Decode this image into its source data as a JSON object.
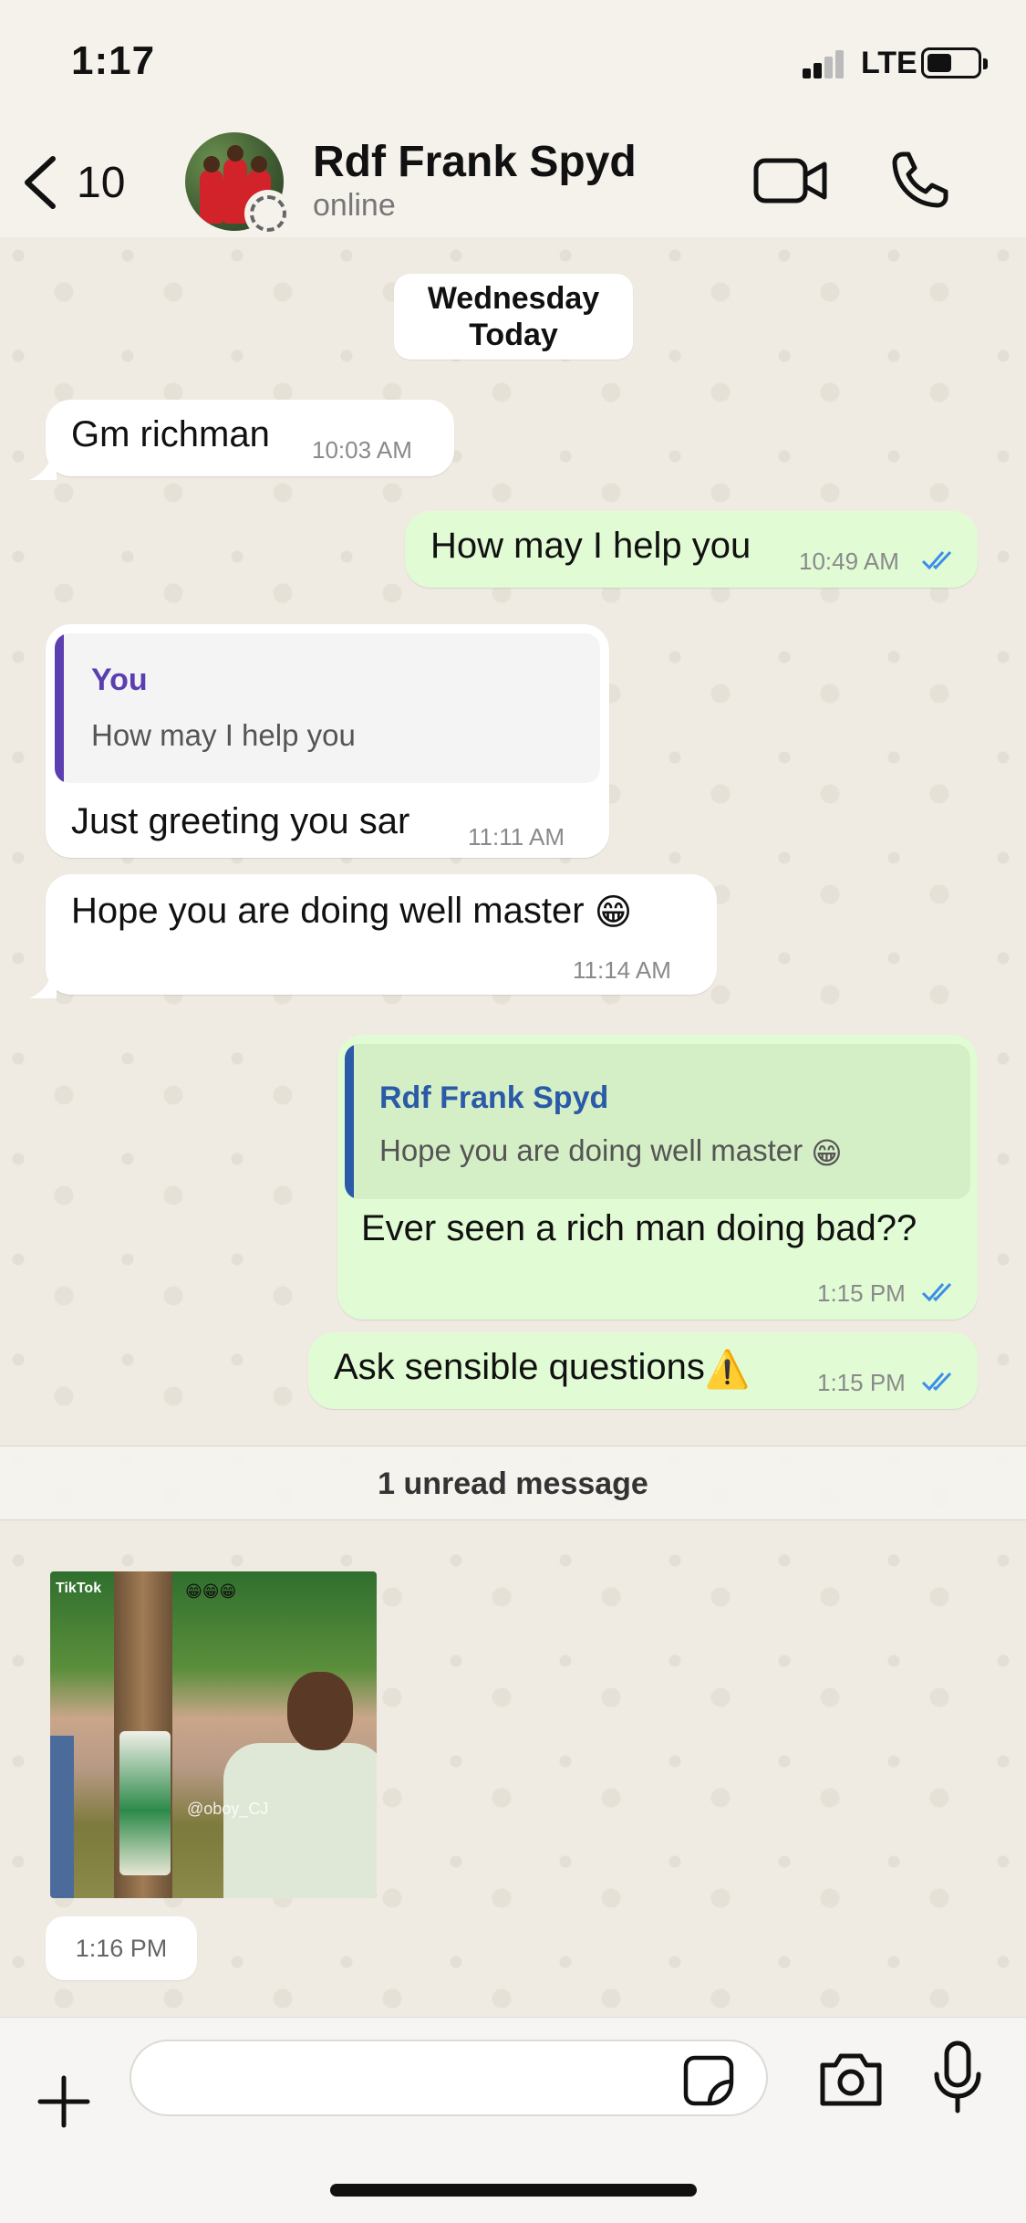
{
  "status_bar": {
    "time": "1:17",
    "network": "LTE"
  },
  "header": {
    "back_count": "10",
    "contact_name": "Rdf Frank Spyd",
    "contact_status": "online"
  },
  "date_pill": {
    "line1": "Wednesday",
    "line2": "Today"
  },
  "messages": [
    {
      "id": "m1",
      "dir": "in",
      "text": "Gm richman",
      "time": "10:03 AM"
    },
    {
      "id": "m2",
      "dir": "out",
      "text": "How may I help you",
      "time": "10:49 AM",
      "read": true
    },
    {
      "id": "m3",
      "dir": "in",
      "quote_author": "You",
      "quote_text": "How may I help you",
      "text": "Just greeting you sar",
      "time": "11:11 AM"
    },
    {
      "id": "m4",
      "dir": "in",
      "text": "Hope you are doing well master",
      "emoji": "😁",
      "time": "11:14 AM"
    },
    {
      "id": "m5",
      "dir": "out",
      "quote_author": "Rdf Frank Spyd",
      "quote_text": "Hope you are doing well master",
      "quote_emoji": "😁",
      "text": "Ever seen a rich man doing bad??",
      "time": "1:15 PM",
      "read": true
    },
    {
      "id": "m6",
      "dir": "out",
      "text": "Ask sensible questions",
      "emoji": "⚠️",
      "time": "1:15 PM",
      "read": true
    }
  ],
  "unread_banner": "1 unread message",
  "video_message": {
    "watermark": "@oboy_CJ",
    "tiktok_label": "TikTok",
    "overlay_emojis": "😁😁😁",
    "time": "1:16 PM"
  },
  "input": {
    "placeholder": ""
  },
  "colors": {
    "incoming_bubble": "#ffffff",
    "outgoing_bubble": "#e1fbd4",
    "read_ticks": "#3b8ee8",
    "quote_bar_you": "#5b3fb0",
    "quote_bar_contact": "#2a5aa8"
  }
}
